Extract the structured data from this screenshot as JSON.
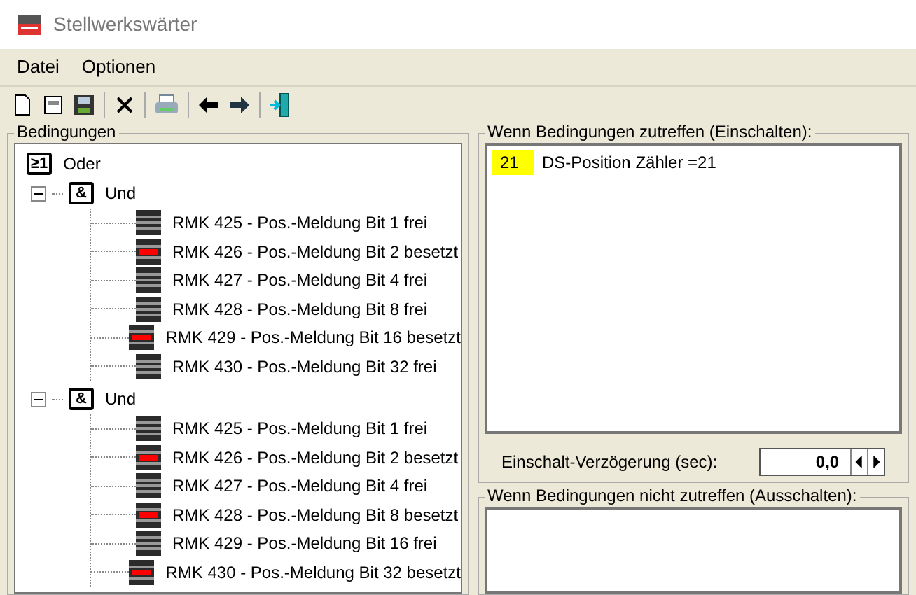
{
  "window": {
    "title": "Stellwerkswärter"
  },
  "menu": [
    "Datei",
    "Optionen"
  ],
  "conditions": {
    "title": "Bedingungen",
    "root": {
      "symbol": "≥1",
      "label": "Oder",
      "expanded": true,
      "children": [
        {
          "symbol": "&",
          "label": "Und",
          "expanded": true,
          "children": [
            {
              "label": "RMK 425 - Pos.-Meldung Bit 1 frei",
              "occupied": false
            },
            {
              "label": "RMK 426 - Pos.-Meldung Bit 2 besetzt",
              "occupied": true
            },
            {
              "label": "RMK 427 - Pos.-Meldung Bit 4 frei",
              "occupied": false
            },
            {
              "label": "RMK 428 - Pos.-Meldung Bit 8 frei",
              "occupied": false
            },
            {
              "label": "RMK 429 - Pos.-Meldung Bit 16 besetzt",
              "occupied": true
            },
            {
              "label": "RMK 430 - Pos.-Meldung Bit 32 frei",
              "occupied": false
            }
          ]
        },
        {
          "symbol": "&",
          "label": "Und",
          "expanded": true,
          "children": [
            {
              "label": "RMK 425 - Pos.-Meldung Bit 1 frei",
              "occupied": false
            },
            {
              "label": "RMK 426 - Pos.-Meldung Bit 2 besetzt",
              "occupied": true
            },
            {
              "label": "RMK 427 - Pos.-Meldung Bit 4 frei",
              "occupied": false
            },
            {
              "label": "RMK 428 - Pos.-Meldung Bit 8 besetzt",
              "occupied": true
            },
            {
              "label": "RMK 429 - Pos.-Meldung Bit 16 frei",
              "occupied": false
            },
            {
              "label": "RMK 430 - Pos.-Meldung Bit 32 besetzt",
              "occupied": true
            }
          ]
        }
      ]
    }
  },
  "on_actions": {
    "title": "Wenn Bedingungen zutreffen (Einschalten):",
    "items": [
      {
        "badge": "21",
        "label": "DS-Position Zähler =21"
      }
    ]
  },
  "delay": {
    "label": "Einschalt-Verzögerung (sec):",
    "value": "0,0"
  },
  "off_actions": {
    "title": "Wenn Bedingungen nicht zutreffen (Ausschalten):"
  }
}
